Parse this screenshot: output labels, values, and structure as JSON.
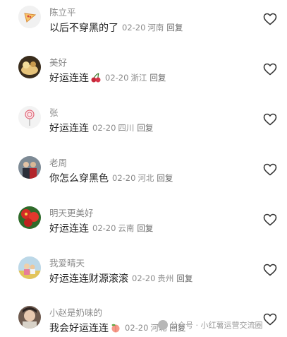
{
  "comments": [
    {
      "user": "陈立平",
      "text": "以后不穿黑的了",
      "date": "02-20",
      "location": "河南",
      "reply": "回复",
      "avatar_icon": "pizza-icon"
    },
    {
      "user": "美好",
      "text": "好运连连",
      "date": "02-20",
      "location": "浙江",
      "reply": "回复",
      "avatar_icon": "photo-avatar",
      "emoji": "cherries-emoji"
    },
    {
      "user": "张",
      "text": "好运连连",
      "date": "02-20",
      "location": "四川",
      "reply": "回复",
      "avatar_icon": "lollipop-icon"
    },
    {
      "user": "老周",
      "text": "你怎么穿黑色",
      "date": "02-20",
      "location": "河北",
      "reply": "回复",
      "avatar_icon": "photo-avatar"
    },
    {
      "user": "明天更美好",
      "text": "好运连连",
      "date": "02-20",
      "location": "云南",
      "reply": "回复",
      "avatar_icon": "flowers-avatar"
    },
    {
      "user": "我爱晴天",
      "text": "好运连连财源滚滚",
      "date": "02-20",
      "location": "贵州",
      "reply": "回复",
      "avatar_icon": "photo-avatar"
    },
    {
      "user": "小赵是奶味的",
      "text": "我会好运连连",
      "date": "02-20",
      "location": "河北",
      "reply": "回复",
      "avatar_icon": "photo-avatar",
      "emoji": "peach-emoji"
    }
  ],
  "watermark": "公众号 · 小红薯运营交流圈",
  "like_icon": "heart-outline-icon",
  "colors": {
    "username": "#8a8a8a",
    "text": "#222222",
    "meta": "#8a8a8a"
  }
}
